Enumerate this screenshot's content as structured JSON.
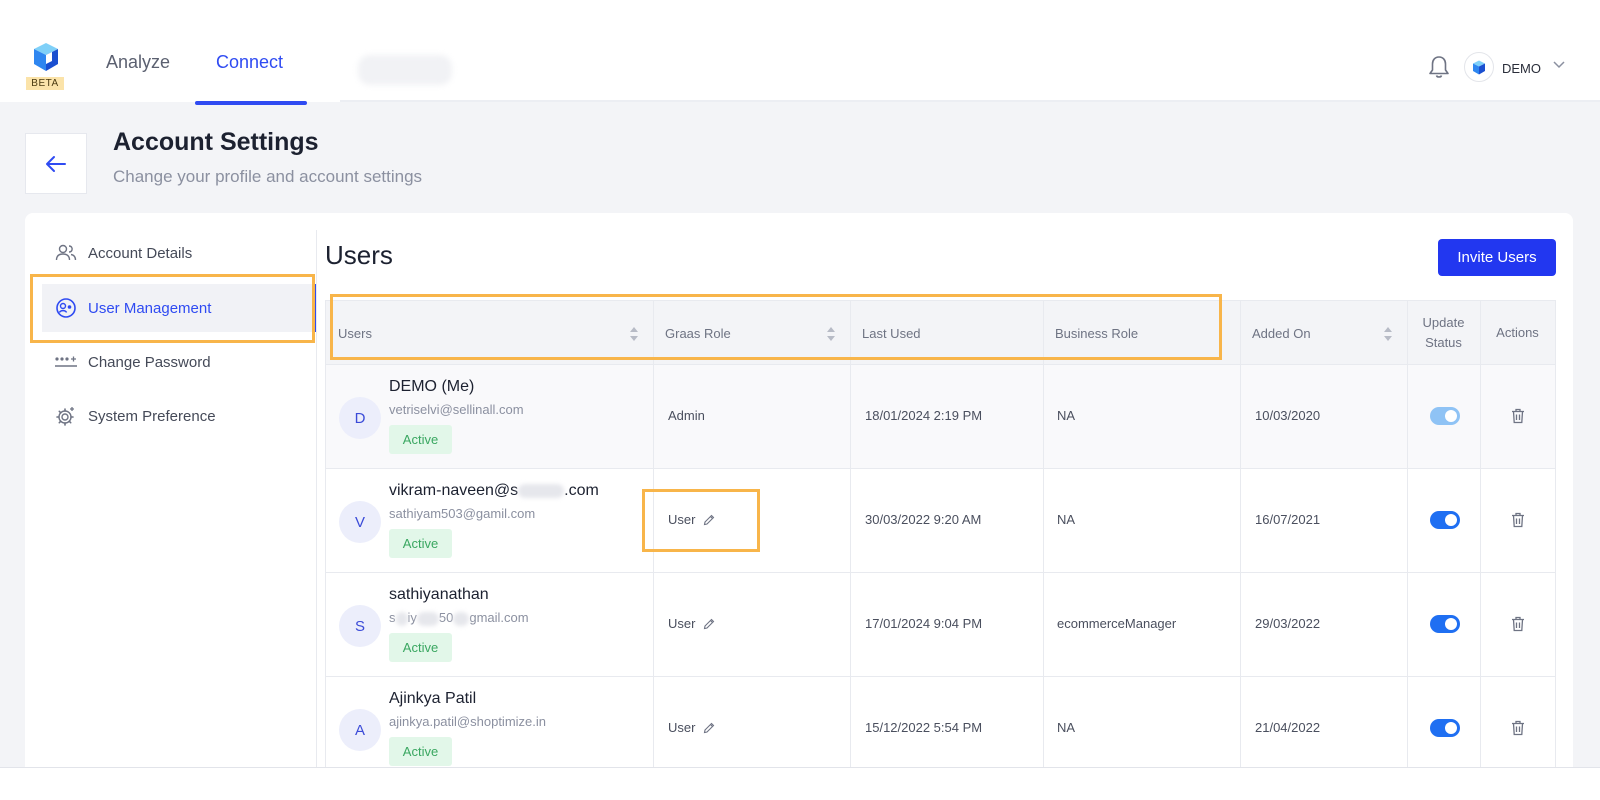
{
  "app": {
    "beta_label": "BETA",
    "nav_tabs": [
      {
        "label": "Analyze",
        "active": false
      },
      {
        "label": "Connect",
        "active": true
      }
    ],
    "user_menu_label": "DEMO"
  },
  "header": {
    "title": "Account Settings",
    "subtitle": "Change your profile and account settings"
  },
  "sidebar": {
    "items": [
      {
        "label": "Account Details",
        "icon": "users-icon",
        "active": false
      },
      {
        "label": "User Management",
        "icon": "user-settings-icon",
        "active": true
      },
      {
        "label": "Change Password",
        "icon": "password-icon",
        "active": false
      },
      {
        "label": "System Preference",
        "icon": "gear-icon",
        "active": false
      }
    ]
  },
  "main": {
    "title": "Users",
    "invite_label": "Invite Users",
    "columns": {
      "users": "Users",
      "graas_role": "Graas Role",
      "last_used": "Last Used",
      "business_role": "Business Role",
      "added_on": "Added On",
      "update_status_1": "Update",
      "update_status_2": "Status",
      "actions": "Actions"
    },
    "rows": [
      {
        "initial": "D",
        "name": "DEMO (Me)",
        "email": "vetriselvi@sellinall.com",
        "status": "Active",
        "graas_role": "Admin",
        "last_used": "18/01/2024 2:19 PM",
        "business_role": "NA",
        "added_on": "10/03/2020",
        "enabled": true
      },
      {
        "initial": "V",
        "name_prefix": "vikram-naveen@s",
        "name_suffix": ".com",
        "email": "sathiyam503@gamil.com",
        "status": "Active",
        "graas_role": "User",
        "last_used": "30/03/2022 9:20 AM",
        "business_role": "NA",
        "added_on": "16/07/2021",
        "enabled": true
      },
      {
        "initial": "S",
        "name": "sathiyanathan",
        "email_a": "s",
        "email_b": "iy",
        "email_c": "50",
        "email_d": "gmail.com",
        "status": "Active",
        "graas_role": "User",
        "last_used": "17/01/2024 9:04 PM",
        "business_role": "ecommerceManager",
        "added_on": "29/03/2022",
        "enabled": true
      },
      {
        "initial": "A",
        "name": "Ajinkya Patil",
        "email": "ajinkya.patil@shoptimize.in",
        "status": "Active",
        "graas_role": "User",
        "last_used": "15/12/2022 5:54 PM",
        "business_role": "NA",
        "added_on": "21/04/2022",
        "enabled": true
      }
    ]
  },
  "colors": {
    "accent": "#2f4bf2",
    "invite_button": "#2237f0",
    "highlight": "#f8b54a",
    "active_badge_bg": "#e2f7e9",
    "active_badge_text": "#3aa761",
    "toggle_on": "#1f6ff2"
  }
}
